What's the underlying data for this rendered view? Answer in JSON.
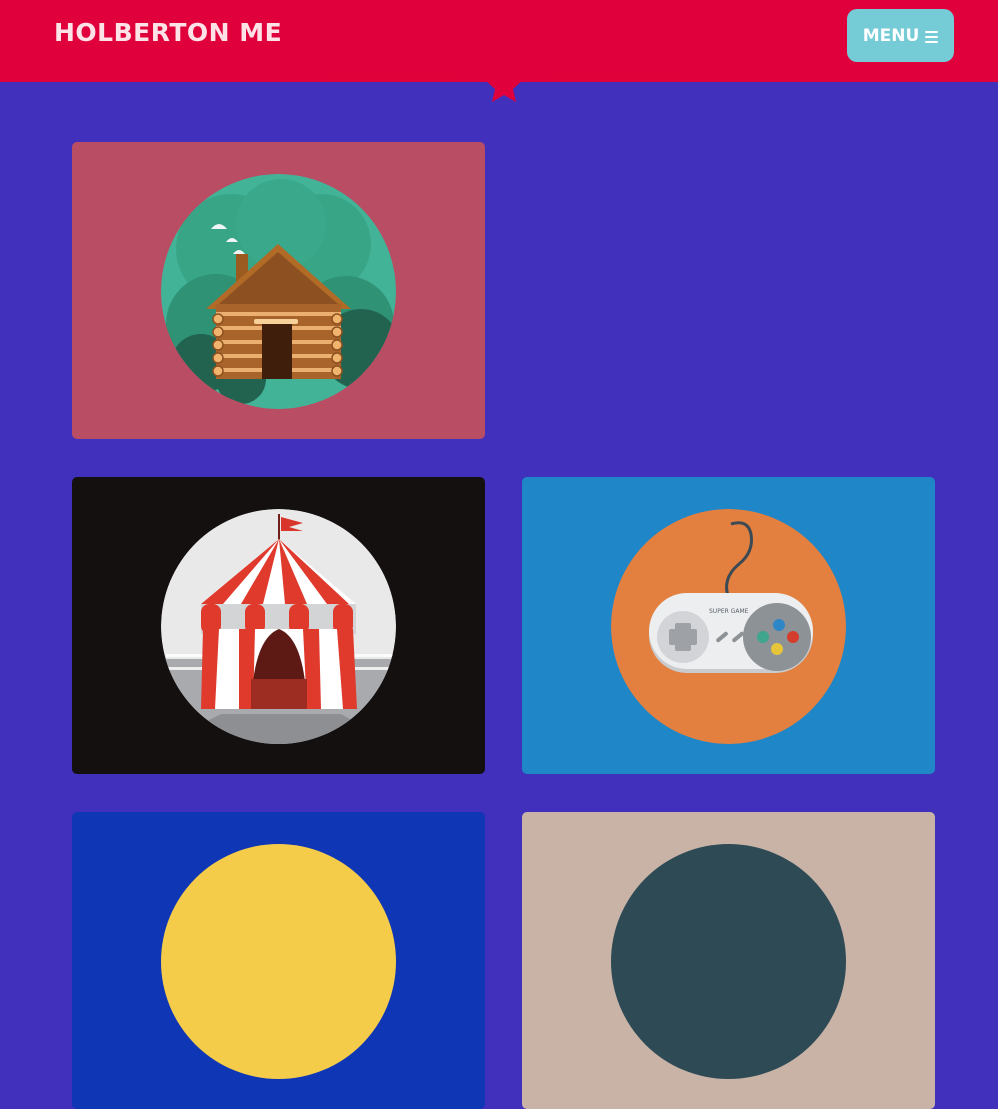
{
  "header": {
    "brand": "HOLBERTON ME",
    "menu_label": "MENU"
  },
  "colors": {
    "background": "#4130bc",
    "header": "#e0003b",
    "menu_button": "#75cbd6",
    "card_cabin": "#b84d63",
    "card_circus": "#141010",
    "card_controller": "#1f86c8",
    "card_blue": "#0f36b4",
    "card_beige": "#c8b3a6"
  },
  "cards": [
    {
      "illustration": "log-cabin-icon",
      "controller_text": ""
    },
    {
      "illustration": "circus-tent-icon",
      "controller_text": ""
    },
    {
      "illustration": "game-controller-icon",
      "controller_text": "SUPER GAME"
    },
    {
      "illustration": "yellow-disc-icon",
      "controller_text": ""
    },
    {
      "illustration": "dark-disc-icon",
      "controller_text": ""
    }
  ]
}
